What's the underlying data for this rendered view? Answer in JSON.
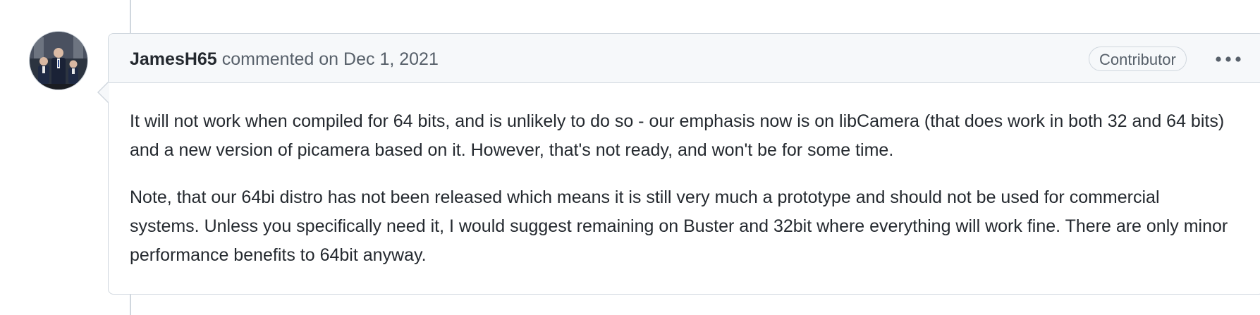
{
  "comment": {
    "author": "JamesH65",
    "action_text": "commented on",
    "date": "Dec 1, 2021",
    "role_badge": "Contributor",
    "menu_icon": "kebab-horizontal-icon",
    "paragraphs": [
      "It will not work when compiled for 64 bits, and is unlikely to do so - our emphasis now is on libCamera (that does work in both 32 and 64 bits) and a new version of picamera based on it. However, that's not ready, and won't be for some time.",
      "Note, that our 64bi distro has not been released which means it is still very much a prototype and should not be used for commercial systems. Unless you specifically need it, I would suggest remaining on Buster and 32bit where everything will work fine. There are only minor performance benefits to 64bit anyway."
    ]
  },
  "colors": {
    "border": "#d0d7de",
    "header_bg": "#f6f8fa",
    "text_primary": "#24292f",
    "text_muted": "#57606a"
  }
}
